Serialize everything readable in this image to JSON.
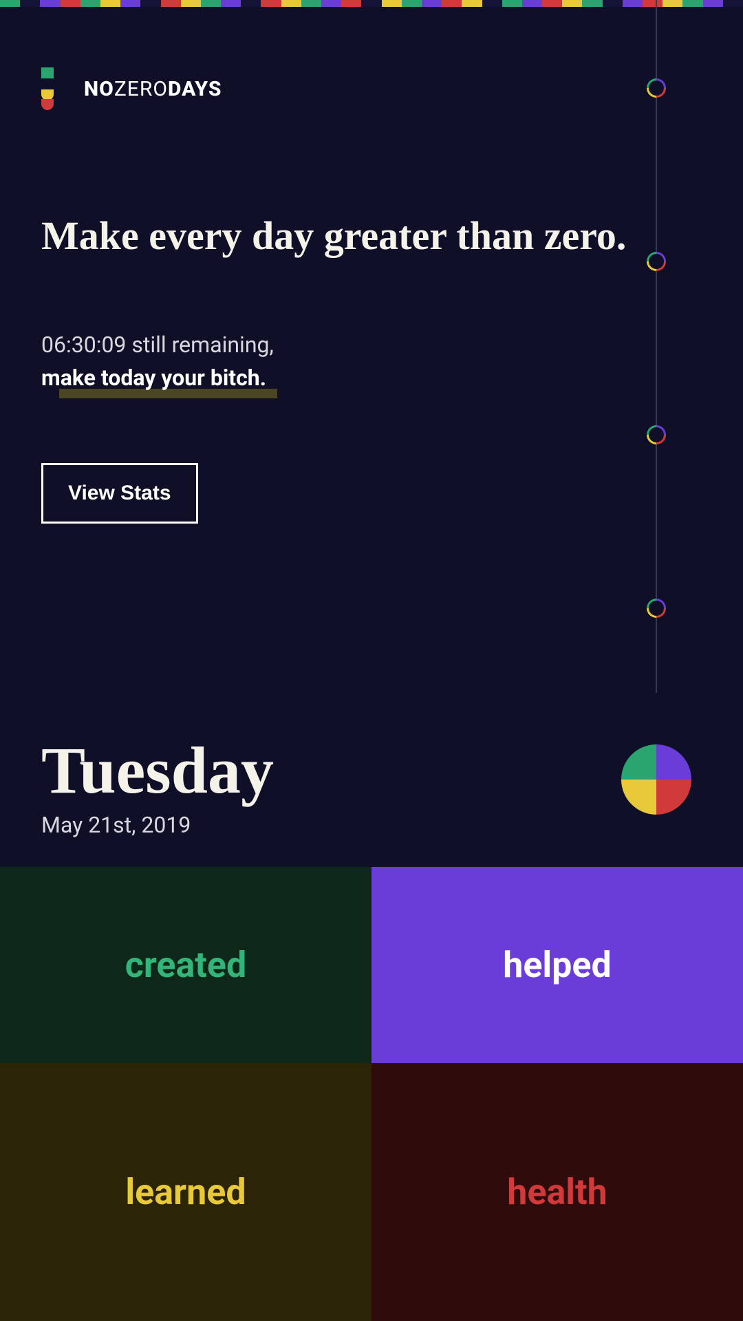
{
  "brand": {
    "segment1": "NO",
    "segment2": "ZERO",
    "segment3": "DAYS"
  },
  "headline": "Make every day greater than zero.",
  "countdown": {
    "time": "06:30:09",
    "suffix": " still remaining,",
    "emphasis": "make today your bitch."
  },
  "cta": {
    "viewStats": "View Stats"
  },
  "today": {
    "dayName": "Tuesday",
    "dateText": "May 21st, 2019"
  },
  "categories": {
    "created": "created",
    "helped": "helped",
    "learned": "learned",
    "health": "health"
  },
  "colors": {
    "green": "#2aa570",
    "purple": "#6a3dd8",
    "yellow": "#e8c93a",
    "red": "#d13a3a",
    "bg": "#0f1028"
  }
}
